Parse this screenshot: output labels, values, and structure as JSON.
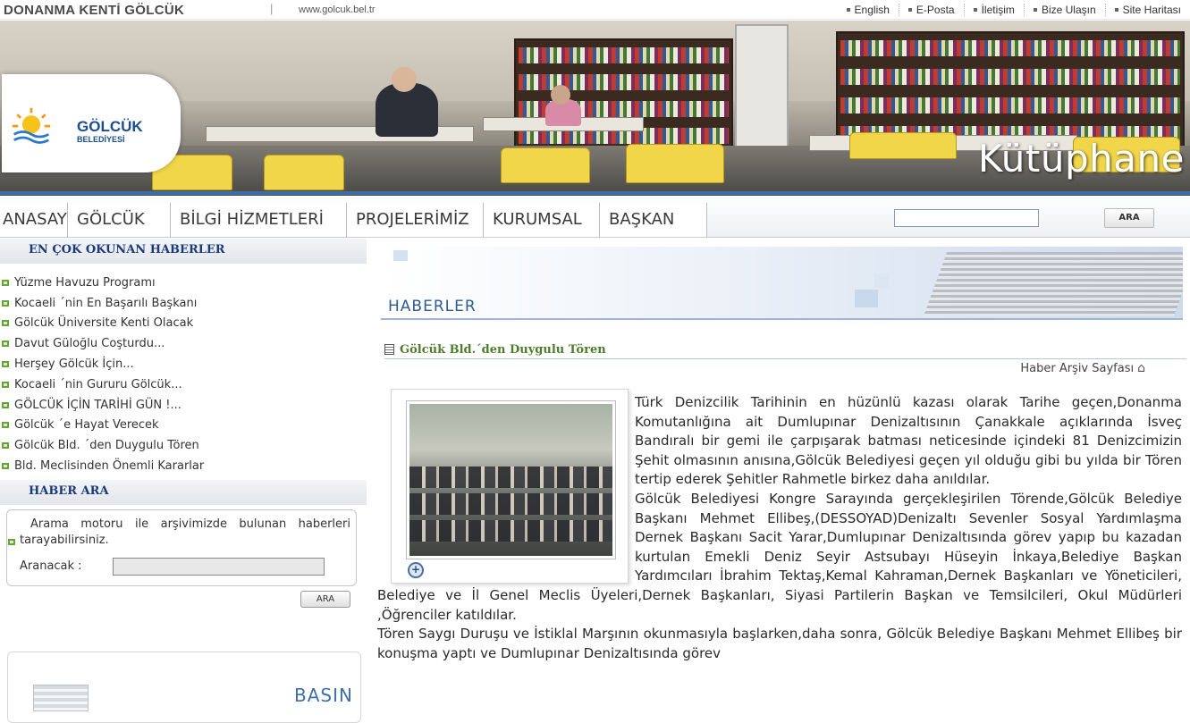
{
  "topbar": {
    "site_title": "DONANMA KENTİ GÖLCÜK",
    "separator": "|",
    "url": "www.golcuk.bel.tr",
    "links": [
      "English",
      "E-Posta",
      "İletişim",
      "Bize Ulaşın",
      "Site Haritası"
    ]
  },
  "banner": {
    "logo_name": "GÖLCÜK",
    "logo_sub": "BELEDİYESİ",
    "page_title": "Kütüphane"
  },
  "nav": {
    "items": [
      "ANASAYFA",
      "GÖLCÜK",
      "BİLGİ HİZMETLERİ",
      "PROJELERİMİZ",
      "KURUMSAL",
      "BAŞKAN"
    ],
    "search_placeholder": "",
    "search_button": "ARA"
  },
  "left": {
    "most_read_title": "EN ÇOK OKUNAN HABERLER",
    "most_read": [
      "Yüzme Havuzu Programı",
      "Kocaeli ´nin En Başarılı Başkanı",
      "Gölcük Üniversite Kenti Olacak",
      "Davut Güloğlu Coşturdu...",
      "Herşey Gölcük İçin...",
      "Kocaeli ´nin Gururu Gölcük...",
      "GÖLCÜK İÇİN TARİHİ GÜN !...",
      "Gölcük ´e Hayat Verecek",
      "Gölcük Bld. ´den Duygulu Tören",
      "Bld. Meclisinden Önemli Kararlar"
    ],
    "search_title": "HABER ARA",
    "search_info": "Arama motoru ile arşivimizde bulunan haberleri tarayabilirsiniz.",
    "search_label": "Aranacak :",
    "search_value": "",
    "search_button": "ARA",
    "press_label": "BASIN"
  },
  "main": {
    "section_title": "HABERLER",
    "article_title": "Gölcük Bld.´den Duygulu Tören",
    "archive_link": "Haber Arşiv Sayfası",
    "paragraphs": [
      "Türk Denizcilik Tarihinin en hüzünlü kazası olarak Tarihe geçen,Donanma Komutanlığına ait Dumlupınar Denizaltısının Çanakkale açıklarında İsveç Bandıralı bir gemi ile çarpışarak batması neticesinde içindeki 81 Denizcimizin Şehit olmasının anısına,Gölcük Belediyesi geçen yıl olduğu gibi bu yılda bir Tören tertip ederek Şehitler Rahmetle birkez daha anıldılar.",
      "Gölcük Belediyesi Kongre Sarayında gerçekleşirilen Törende,Gölcük Belediye Başkanı Mehmet Ellibeş,(DESSOYAD)Denizaltı Sevenler Sosyal Yardımlaşma Dernek Başkanı Sacit Yarar,Dumlupınar Denizaltısında görev yapıp bu kazadan kurtulan Emekli Deniz Seyir Astsubayı Hüseyin İnkaya,Belediye Başkan Yardımcıları İbrahim Tektaş,Kemal Kahraman,Dernek Başkanları ve Yöneticileri, Belediye ve İl Genel  Meclis Üyeleri,Dernek Başkanları, Siyasi Partilerin Başkan ve Temsilcileri, Okul Müdürleri ,Öğrenciler katıldılar.",
      "Tören Saygı Duruşu ve İstiklal Marşının okunmasıyla başlarken,daha sonra, Gölcük Belediye Başkanı Mehmet Ellibeş bir konuşma yaptı ve Dumlupınar Denizaltısında görev"
    ]
  },
  "colors": {
    "nav_text": "#3a3a3a",
    "section_heading": "#1b3a78",
    "article_title": "#4f7d2d",
    "haberler": "#2f5b92",
    "bullet": "#6aa33a"
  }
}
